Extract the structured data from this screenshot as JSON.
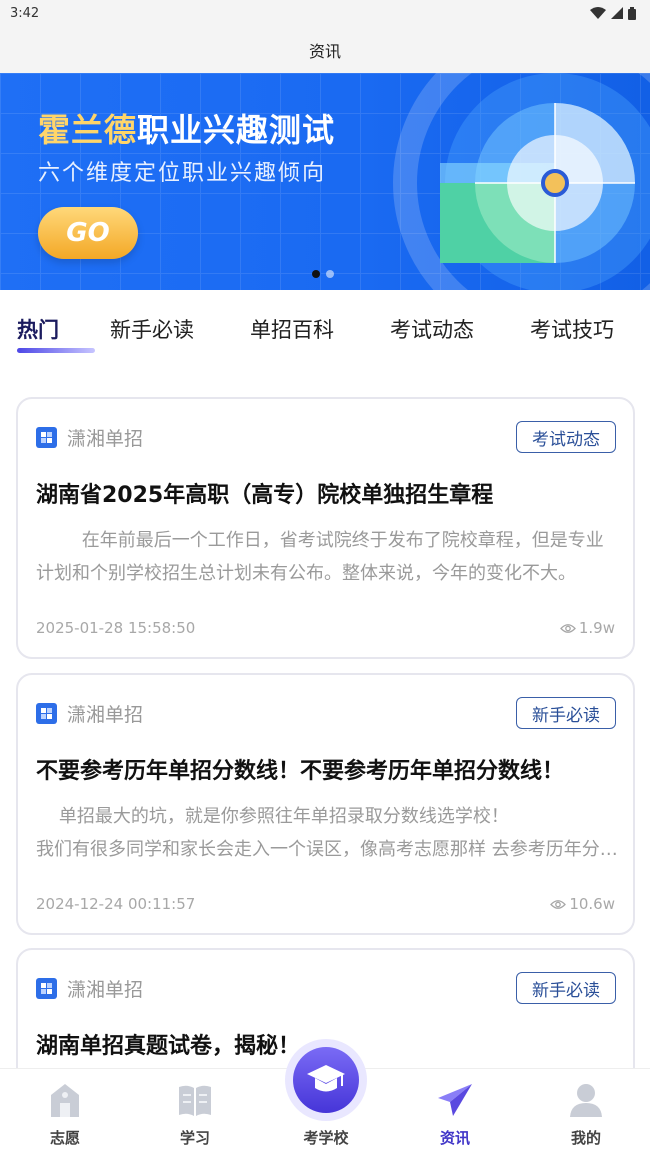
{
  "status_bar": {
    "time": "3:42"
  },
  "header": {
    "title": "资讯"
  },
  "banner": {
    "title_highlight": "霍兰德",
    "title_rest": "职业兴趣测试",
    "subtitle": "六个维度定位职业兴趣倾向",
    "go_label": "GO"
  },
  "tabs": [
    {
      "label": "热门",
      "active": true
    },
    {
      "label": "新手必读"
    },
    {
      "label": "单招百科"
    },
    {
      "label": "考试动态"
    },
    {
      "label": "考试技巧"
    }
  ],
  "articles": [
    {
      "source": "潇湘单招",
      "tag": "考试动态",
      "title": "湖南省2025年高职（高专）院校单独招生章程",
      "excerpt": "        在年前最后一个工作日，省考试院终于发布了院校章程，但是专业计划和个别学校招生总计划未有公布。整体来说，今年的变化不大。",
      "date": "2025-01-28 15:58:50",
      "views": "1.9w"
    },
    {
      "source": "潇湘单招",
      "tag": "新手必读",
      "title": "不要参考历年单招分数线！不要参考历年单招分数线！",
      "excerpt": "    单招最大的坑，就是你参照往年单招录取分数线选学校！\n我们有很多同学和家长会走入一个误区，像高考志愿那样 去参考历年分数线。",
      "date": "2024-12-24 00:11:57",
      "views": "10.6w"
    },
    {
      "source": "潇湘单招",
      "tag": "新手必读",
      "title": "湖南单招真题试卷，揭秘！",
      "excerpt": "",
      "date": "",
      "views": ""
    }
  ],
  "bottom_nav": [
    {
      "label": "志愿",
      "icon": "building-icon"
    },
    {
      "label": "学习",
      "icon": "book-icon"
    },
    {
      "label": "考学校",
      "icon": "graduation-cap-icon"
    },
    {
      "label": "资讯",
      "icon": "paper-plane-icon",
      "active": true
    },
    {
      "label": "我的",
      "icon": "user-icon"
    }
  ],
  "colors": {
    "accent": "#4136c8",
    "banner_blue": "#1a6af2",
    "go_button": "#f3a826"
  }
}
